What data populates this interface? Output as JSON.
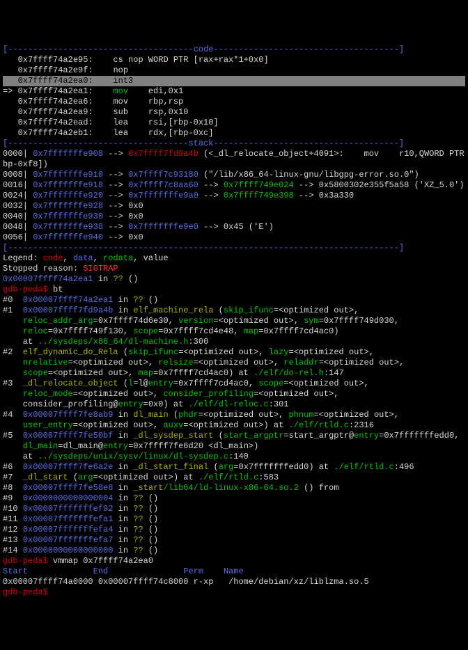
{
  "sections": {
    "code_sep": "[-------------------------------------code-------------------------------------]",
    "stack_sep": "[------------------------------------stack-------------------------------------]",
    "end_sep": "[------------------------------------------------------------------------------]"
  },
  "code_lines": [
    {
      "addr": "0x7ffff74a2e95",
      "op": "cs nop WORD PTR [rax+rax*1+0x0]",
      "hl": false,
      "arrow": "   "
    },
    {
      "addr": "0x7ffff74a2e9f",
      "op": "nop",
      "hl": false,
      "arrow": "   "
    },
    {
      "addr": "0x7ffff74a2ea0",
      "op": "int3",
      "hl": true,
      "arrow": "   "
    },
    {
      "addr": "0x7ffff74a2ea1",
      "op": "mov    edi,0x1",
      "green": true,
      "arrow": "=> "
    },
    {
      "addr": "0x7ffff74a2ea6",
      "op": "mov    rbp,rsp",
      "arrow": "   "
    },
    {
      "addr": "0x7ffff74a2ea9",
      "op": "sub    rsp,0x10",
      "arrow": "   "
    },
    {
      "addr": "0x7ffff74a2ead",
      "op": "lea    rsi,[rbp-0x10]",
      "arrow": "   "
    },
    {
      "addr": "0x7ffff74a2eb1",
      "op": "lea    rdx,[rbp-0xc]",
      "arrow": "   "
    }
  ],
  "stack_lines": [
    {
      "off": "0000",
      "addr": "0x7fffffffe908",
      "arrow": "-->",
      "t1": "0x7ffff7fd9a4b",
      "t1c": "red",
      "tail": " (<_dl_relocate_object+4091>:    mov    r10,QWORD PTR [r"
    },
    {
      "cont": "bp-0xf8])"
    },
    {
      "off": "0008",
      "addr": "0x7fffffffe910",
      "arrow": "-->",
      "t1": "0x7ffff7c93180",
      "t1c": "blue",
      "tail": " (\"/lib/x86_64-linux-gnu/libgpg-error.so.0\")"
    },
    {
      "off": "0016",
      "addr": "0x7fffffffe918",
      "arrow": "-->",
      "t1": "0x7ffff7c8aa60",
      "t1c": "blue",
      "arrow2": "-->",
      "t2": "0x7ffff749e024",
      "t2c": "green",
      "tail": " --> 0x5800302e355f5a58 ('XZ_5.0')"
    },
    {
      "off": "0024",
      "addr": "0x7fffffffe920",
      "arrow": "-->",
      "t1": "0x7fffffffe9a0",
      "t1c": "blue",
      "arrow2": "-->",
      "t2": "0x7ffff749e398",
      "t2c": "green",
      "tail": " --> 0x3a330"
    },
    {
      "off": "0032",
      "addr": "0x7fffffffe928",
      "arrow": "-->",
      "t1": "0x0",
      "t1c": "white"
    },
    {
      "off": "0040",
      "addr": "0x7fffffffe930",
      "arrow": "-->",
      "t1": "0x0",
      "t1c": "white"
    },
    {
      "off": "0048",
      "addr": "0x7fffffffe938",
      "arrow": "-->",
      "t1": "0x7fffffffe9e0",
      "t1c": "blue",
      "tail": " --> 0x45 ('E')"
    },
    {
      "off": "0056",
      "addr": "0x7fffffffe940",
      "arrow": "-->",
      "t1": "0x0",
      "t1c": "white"
    }
  ],
  "legend": {
    "label": "Legend:",
    "code": "code",
    "data": "data",
    "rodata": "rodata",
    "value": "value"
  },
  "stopped": {
    "label": "Stopped reason:",
    "value": "SIGTRAP"
  },
  "stopline": {
    "addr": "0x00007ffff74a2ea1",
    "in": "in",
    "fn": "??",
    "paren": "()"
  },
  "prompt": "gdb-peda$",
  "cmd_bt": "bt",
  "cmd_vmmap": "vmmap 0x7ffff74a2ea0",
  "bt": [
    {
      "n": "#0 ",
      "addr": "0x00007ffff74a2ea1",
      "rest_plain": " in ",
      "fn": "??",
      "tail": " ()"
    },
    {
      "n": "#1 ",
      "addr": "0x00007ffff7fd9a4b",
      "rest_plain": " in ",
      "fn": "elf_machine_rela",
      "args": " (",
      "kv": "skip_ifunc=<optimized out>,",
      "cont": true
    },
    {
      "raw": "    reloc_addr_arg=0x7ffff74d6e30, version=<optimized out>, sym=0x7ffff749d030,"
    },
    {
      "raw": "    reloc=0x7ffff749f130, scope=0x7ffff7cd4e48, map=0x7ffff7cd4ac0)"
    },
    {
      "at": "    at ",
      "path": "../sysdeps/x86_64/dl-machine.h",
      "line": ":300"
    },
    {
      "n": "#2 ",
      "fn": "elf_dynamic_do_Rela",
      "args": " (skip_ifunc=<optimized out>, lazy=<optimized out>,"
    },
    {
      "raw": "    nrelative=<optimized out>, relsize=<optimized out>, reladdr=<optimized out>,"
    },
    {
      "raw2": "    scope=<optimized out>, map=0x7ffff7cd4ac0) at ",
      "path": "./elf/do-rel.h",
      "line": ":147"
    },
    {
      "n": "#3 ",
      "fn": "_dl_relocate_object",
      "args": " (l=l@entry=0x7ffff7cd4ac0, scope=<optimized out>,"
    },
    {
      "raw": "    reloc_mode=<optimized out>, consider_profiling=<optimized out>,"
    },
    {
      "raw2": "    consider_profiling@entry=0x0) at ",
      "path": "./elf/dl-reloc.c",
      "line": ":301"
    },
    {
      "n": "#4 ",
      "addr": "0x00007ffff7fe8ab9",
      "rest_plain": " in ",
      "fn": "dl_main",
      "args": " (phdr=<optimized out>, phnum=<optimized out>,"
    },
    {
      "raw2": "    user_entry=<optimized out>, auxv=<optimized out>) at ",
      "path": "./elf/rtld.c",
      "line": ":2316"
    },
    {
      "n": "#5 ",
      "addr": "0x00007ffff7fe50bf",
      "rest_plain": " in ",
      "fn": "_dl_sysdep_start",
      "args": " (start_argptr=start_argptr@entry=0x7fffffffedd0,"
    },
    {
      "raw": "    dl_main=dl_main@entry=0x7ffff7fe6d20 <dl_main>)"
    },
    {
      "at": "    at ",
      "path": "../sysdeps/unix/sysv/linux/dl-sysdep.c",
      "line": ":140"
    },
    {
      "n": "#6 ",
      "addr": "0x00007ffff7fe6a2e",
      "rest_plain": " in ",
      "fn": "_dl_start_final",
      "args": " (arg=0x7fffffffedd0) at ",
      "path": "./elf/rtld.c",
      "line": ":496"
    },
    {
      "n": "#7 ",
      "fn": "_dl_start",
      "args": " (arg=<optimized out>) at ",
      "path": "./elf/rtld.c",
      "line": ":583"
    },
    {
      "n": "#8 ",
      "addr": "0x00007ffff7fe58e8",
      "rest_plain": " in ",
      "fn": "_start",
      "tail": " () from ",
      "path": "/lib64/ld-linux-x86-64.so.2"
    },
    {
      "n": "#9 ",
      "addr": "0x0000000000000004",
      "rest_plain": " in ",
      "fn": "??",
      "tail": " ()"
    },
    {
      "n": "#10",
      "addr": "0x00007fffffffef92",
      "rest_plain": " in ",
      "fn": "??",
      "tail": " ()"
    },
    {
      "n": "#11",
      "addr": "0x00007fffffffefa1",
      "rest_plain": " in ",
      "fn": "??",
      "tail": " ()"
    },
    {
      "n": "#12",
      "addr": "0x00007fffffffefa4",
      "rest_plain": " in ",
      "fn": "??",
      "tail": " ()"
    },
    {
      "n": "#13",
      "addr": "0x00007fffffffefa7",
      "rest_plain": " in ",
      "fn": "??",
      "tail": " ()"
    },
    {
      "n": "#14",
      "addr": "0x0000000000000000",
      "rest_plain": " in ",
      "fn": "??",
      "tail": " ()"
    }
  ],
  "vmmap": {
    "hdr_start": "Start             ",
    "hdr_end": "End               ",
    "hdr_perm": "Perm    ",
    "hdr_name": "Name",
    "start": "0x00007ffff74a0000",
    "end": "0x00007ffff74c8000",
    "perm": "r-xp   ",
    "name": "/home/debian/xz/liblzma.so.5"
  }
}
